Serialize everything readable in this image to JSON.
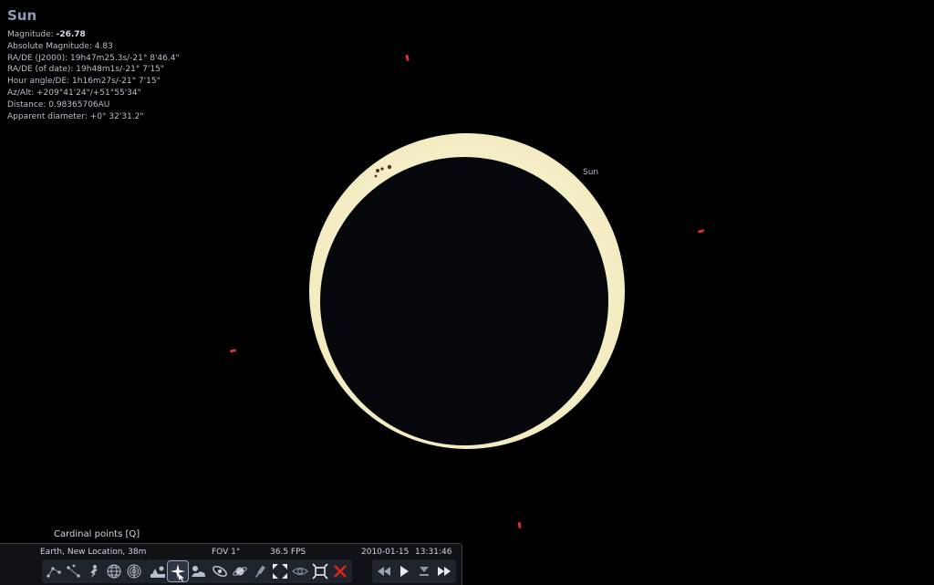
{
  "object": {
    "name": "Sun",
    "magnitude_label": "Magnitude:",
    "magnitude_value": "-26.78",
    "absolute_magnitude": "Absolute Magnitude: 4.83",
    "radec_j2000": "RA/DE (J2000): 19h47m25.3s/-21° 8'46.4\"",
    "radec_date": "RA/DE (of date): 19h48m1s/-21° 7'15\"",
    "hour_angle": "Hour angle/DE: 1h16m27s/-21° 7'15\"",
    "az_alt": "Az/Alt: +209°41'24\"/+51°55'34\"",
    "distance": "Distance: 0.98365706AU",
    "apparent_diameter": "Apparent diameter: +0° 32'31.2\""
  },
  "sky": {
    "sun_label": "Sun",
    "sun_color": "#fdf8d8",
    "moon_color": "#06070a",
    "marker_color": "#e0302a"
  },
  "tooltip": "Cardinal points  [Q]",
  "status": {
    "location": "Earth, New Location, 38m",
    "fov": "FOV 1°",
    "fps": "36.5 FPS",
    "date": "2010-01-15",
    "time": "13:31:46"
  },
  "toolbar": {
    "buttons": [
      "constellation-lines-icon",
      "constellation-names-icon",
      "constellation-art-icon",
      "equatorial-grid-icon",
      "azimuthal-grid-icon",
      "ground-icon",
      "cardinal-points-icon",
      "atmosphere-icon",
      "nebulae-icon",
      "planet-hints-icon",
      "equatorial-mount-icon",
      "center-selected-icon",
      "night-mode-icon",
      "fullscreen-icon",
      "quit-icon",
      "rewind-icon",
      "play-icon",
      "now-icon",
      "fast-forward-icon"
    ]
  }
}
